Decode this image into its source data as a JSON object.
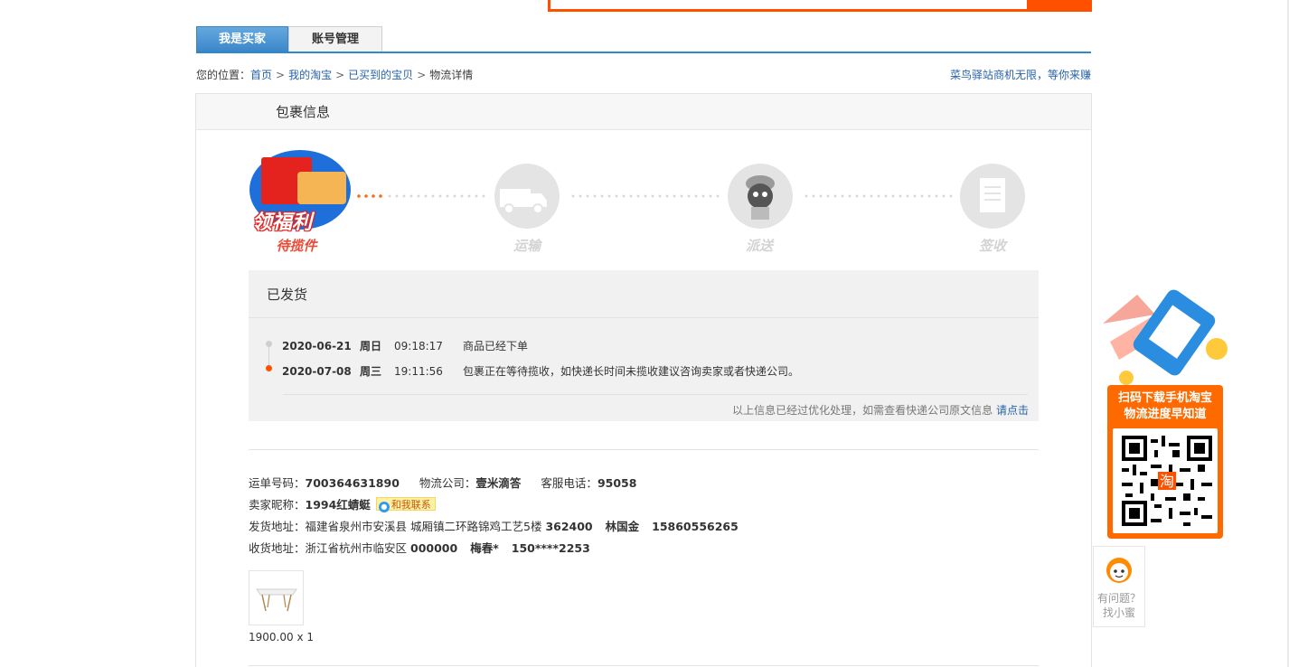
{
  "tabs": {
    "buyer": "我是买家",
    "account": "账号管理"
  },
  "breadcrumb": {
    "prefix": "您的位置：",
    "home": "首页",
    "taobao": "我的淘宝",
    "bought": "已买到的宝贝",
    "current": "物流详情",
    "sep": ">"
  },
  "promo_link": "菜鸟驿站商机无限，等你来赚",
  "package_title": "包裹信息",
  "badge_text": "领福利",
  "steps": [
    {
      "label": "待揽件",
      "state": "current"
    },
    {
      "label": "运输",
      "state": "todo"
    },
    {
      "label": "派送",
      "state": "todo"
    },
    {
      "label": "签收",
      "state": "todo"
    }
  ],
  "status": {
    "title": "已发货",
    "traces": [
      {
        "date": "2020-06-21",
        "week": "周日",
        "time": "09:18:17",
        "desc": "商品已经下单"
      },
      {
        "date": "2020-07-08",
        "week": "周三",
        "time": "19:11:56",
        "desc": "包裹正在等待揽收，如快递长时间未揽收建议咨询卖家或者快递公司。"
      }
    ],
    "note": "以上信息已经过优化处理，如需查看快递公司原文信息",
    "note_link": "请点击"
  },
  "info": {
    "waybill_label": "运单号码：",
    "waybill": "700364631890",
    "company_label": "物流公司：",
    "company": "壹米滴答",
    "phone_label": "客服电话：",
    "phone": "95058",
    "seller_label": "卖家昵称：",
    "seller": "1994红蜻蜓",
    "contact": "和我联系",
    "from_label": "发货地址：",
    "from_addr": "福建省泉州市安溪县 城厢镇二环路锦鸡工艺5楼",
    "from_zip": "362400",
    "from_name": "林国金",
    "from_phone": "15860556265",
    "to_label": "收货地址：",
    "to_addr": "浙江省杭州市临安区",
    "to_zip": "000000",
    "to_name": "梅春*",
    "to_phone": "150****2253"
  },
  "item": {
    "price_qty": "1900.00 x 1"
  },
  "app_widget": {
    "line1": "扫码下载手机淘宝",
    "line2": "物流进度早知道",
    "qr_center": "淘"
  },
  "help": {
    "line1": "有问题？",
    "line2": "找小蜜"
  },
  "colors": {
    "orange": "#ff5000",
    "blue": "#2c8ac9",
    "link": "#2762a8",
    "red": "#ef4a35"
  }
}
